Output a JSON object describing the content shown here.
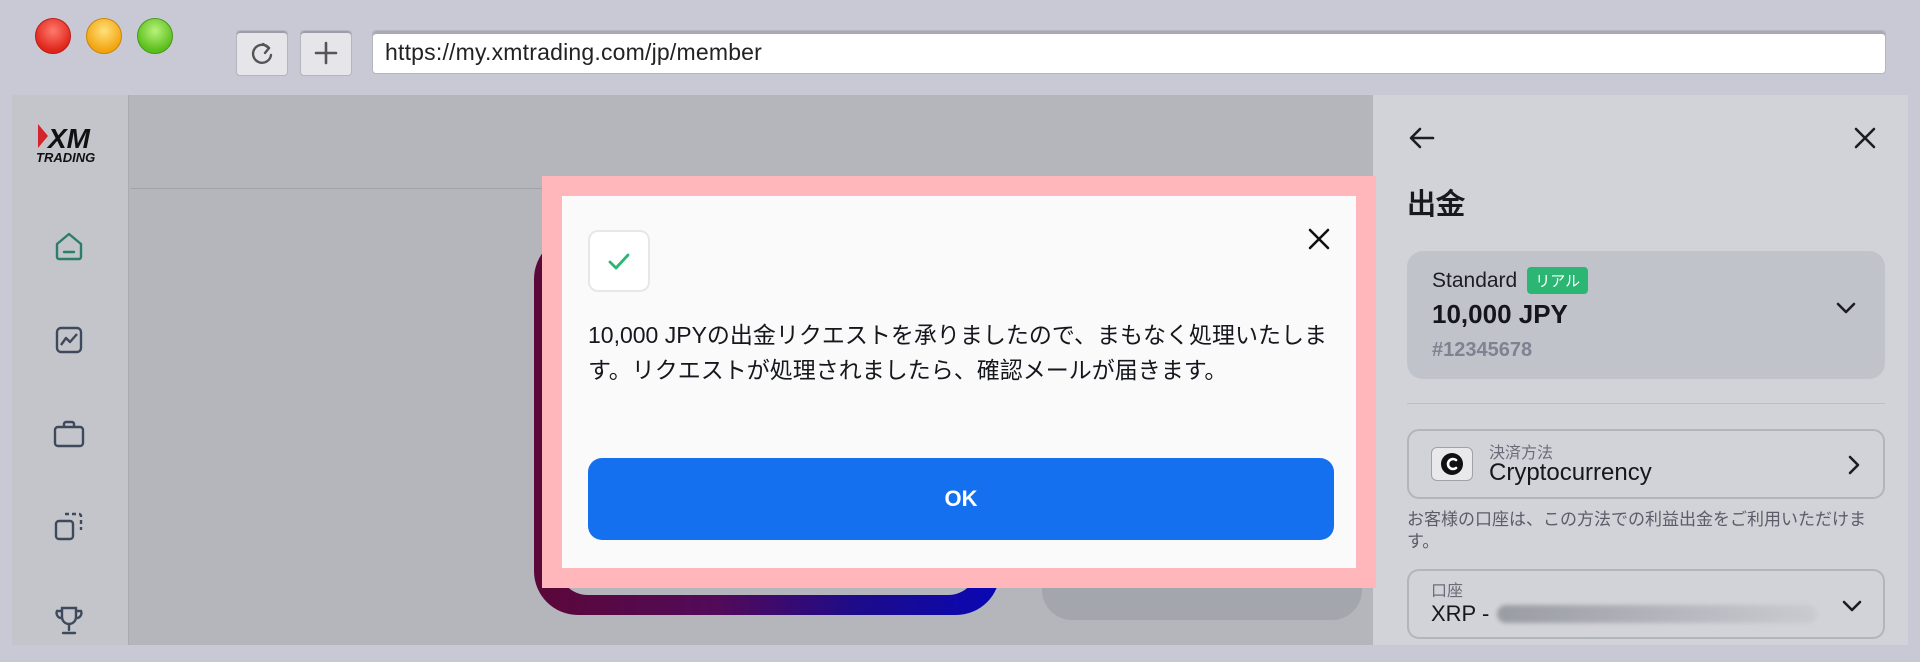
{
  "browser": {
    "url": "https://my.xmtrading.com/jp/member",
    "reload_icon": "reload-icon",
    "new_tab_icon": "plus-icon"
  },
  "sidebar": {
    "logo_text": "XM",
    "logo_sub": "TRADING",
    "items": [
      {
        "icon": "home-icon"
      },
      {
        "icon": "chart-icon"
      },
      {
        "icon": "briefcase-icon"
      },
      {
        "icon": "copy-icon"
      },
      {
        "icon": "trophy-icon"
      }
    ]
  },
  "drawer": {
    "title": "出金",
    "account": {
      "type": "Standard",
      "badge": "リアル",
      "balance": "10,000 JPY",
      "number": "#12345678"
    },
    "payment_method": {
      "label": "決済方法",
      "value": "Cryptocurrency"
    },
    "note": "お客様の口座は、この方法での利益出金をご利用いただけます。",
    "wallet": {
      "label": "口座",
      "value_prefix": "XRP -"
    }
  },
  "modal": {
    "message": "10,000 JPYの出金リクエストを承りましたので、まもなく処理いたします。リクエストが処理されましたら、確認メールが届きます。",
    "ok_label": "OK"
  },
  "colors": {
    "accent": "#1570ef",
    "success": "#2bb673",
    "highlight_frame": "#ffb7bb"
  }
}
